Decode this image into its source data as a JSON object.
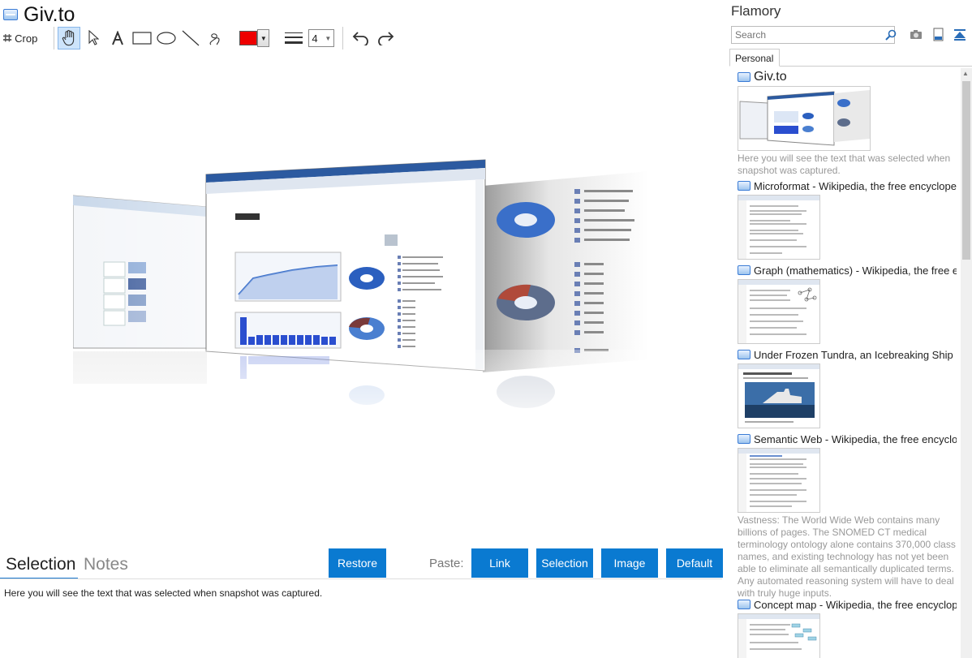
{
  "app": {
    "title": "Giv.to"
  },
  "toolbar": {
    "crop_label": "Crop",
    "line_width": "4",
    "color": "#ee0000"
  },
  "bottom": {
    "tabs": [
      {
        "label": "Selection",
        "active": true
      },
      {
        "label": "Notes",
        "active": false
      }
    ],
    "restore_label": "Restore",
    "paste_label": "Paste:",
    "paste_buttons": [
      "Link",
      "Selection",
      "Image",
      "Default"
    ],
    "selection_text": "Here you will see the text that was selected when snapshot was captured."
  },
  "sidebar": {
    "title": "Flamory",
    "search_placeholder": "Search",
    "tab_label": "Personal",
    "items": [
      {
        "title": "Giv.to",
        "desc": "Here you will see the text that was selected when snapshot was captured."
      },
      {
        "title": "Microformat - Wikipedia, the free encyclopedia"
      },
      {
        "title": "Graph (mathematics) - Wikipedia, the free encyclopedia"
      },
      {
        "title": "Under Frozen Tundra, an Icebreaking Ship Uncovers"
      },
      {
        "title": "Semantic Web - Wikipedia, the free encyclopedia",
        "desc": "Vastness: The World Wide Web contains many billions of pages. The SNOMED CT medical terminology ontology alone contains 370,000 class names, and existing technology has not yet been able to eliminate all semantically duplicated terms. Any automated reasoning system will have to deal with truly huge inputs."
      },
      {
        "title": "Concept map - Wikipedia, the free encyclopedia"
      }
    ]
  },
  "colors": {
    "accent": "#0a7ad1"
  }
}
